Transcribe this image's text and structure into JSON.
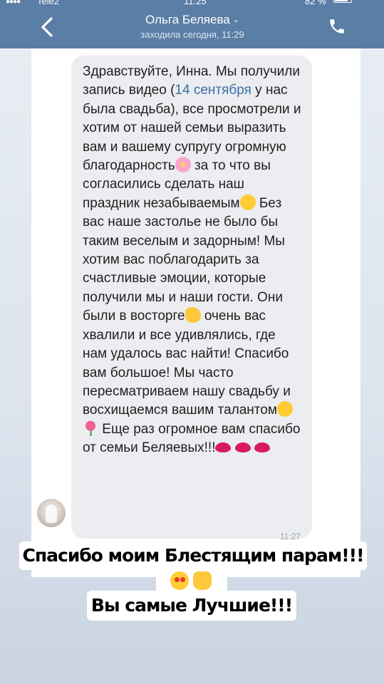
{
  "status_bar": {
    "carrier": "Tele2",
    "time": "11:25",
    "battery": "82 %"
  },
  "header": {
    "contact_name": "Ольга Беляева",
    "last_seen": "заходила сегодня, 11:29",
    "back_icon": "chevron-left-icon",
    "call_icon": "phone-icon"
  },
  "message": {
    "part1": "Здравствуйте, Инна. Мы получили запись видео (",
    "date_link": "14 сентября",
    "part2": " у нас была свадьба), все просмотрели и хотим от нашей семьи выразить вам и вашему супругу огромную благодарность",
    "part3": " за то что вы согласились сделать наш праздник незабываемым",
    "part4": " Без вас наше застолье не было бы таким веселым и задорным! Мы хотим вас поблагодарить за счастливые эмоции, которые получили мы и наши гости. Они были в восторге",
    "part5": " очень вас хвалили и все  удивлялись, где нам удалось вас найти! Спасибо вам большое!  Мы часто пересматриваем нашу свадьбу и восхищаемся вашим талантом",
    "part6": " Еще раз огромное вам спасибо от семьи Беляевых!!!",
    "time": "11:27"
  },
  "story": {
    "caption1": "Спасибо моим Блестящим парам!!!",
    "caption2": "Вы самые Лучшие!!!"
  },
  "colors": {
    "header": "#5b7ea6",
    "bubble": "#ebedf0",
    "link": "#3d6fa4"
  }
}
